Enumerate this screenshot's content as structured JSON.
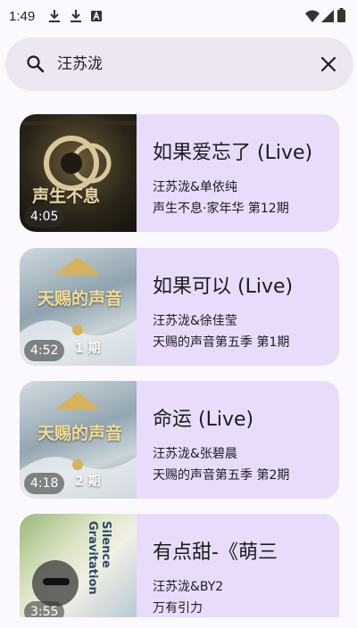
{
  "status_bar": {
    "time": "1:49",
    "left_icons": [
      "download-icon",
      "download-icon",
      "text-app-icon"
    ],
    "right_icons": [
      "wifi-icon",
      "signal-icon",
      "battery-icon"
    ]
  },
  "search": {
    "query": "汪苏泷",
    "icon": "search-icon",
    "clear_icon": "close-icon"
  },
  "results": [
    {
      "title": "如果爱忘了 (Live)",
      "artist": "汪苏泷&单依纯",
      "album": "声生不息·家年华 第12期",
      "duration": "4:05",
      "thumb_text": "声生不息"
    },
    {
      "title": "如果可以 (Live)",
      "artist": "汪苏泷&徐佳莹",
      "album": "天赐的声音第五季 第1期",
      "duration": "4:52",
      "thumb_text": "天赐的声音",
      "thumb_episode": "1 期"
    },
    {
      "title": "命运 (Live)",
      "artist": "汪苏泷&张碧晨",
      "album": "天赐的声音第五季 第2期",
      "duration": "4:18",
      "thumb_text": "天赐的声音",
      "thumb_episode": "2 期"
    },
    {
      "title": "有点甜-《萌三",
      "artist": "汪苏泷&BY2",
      "album": "万有引力",
      "duration": "3:55",
      "thumb_text": "Silence Gravitation"
    }
  ],
  "colors": {
    "background": "#fbf8fe",
    "search_bar": "#ece7f1",
    "card": "#e9dcfb"
  }
}
